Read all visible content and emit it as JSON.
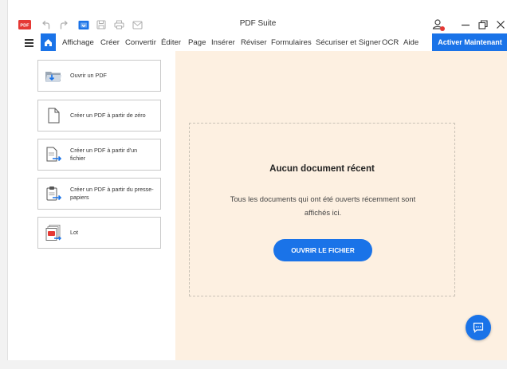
{
  "window": {
    "title": "PDF Suite",
    "logo_text": "PDF",
    "controls": [
      "minimize",
      "restore",
      "close"
    ]
  },
  "quick_access": [
    "undo-icon",
    "redo-icon",
    "open-folder-icon",
    "save-icon",
    "print-icon",
    "email-icon"
  ],
  "menu": {
    "items": [
      "Affichage",
      "Créer",
      "Convertir",
      "Éditer",
      "Page",
      "Insérer",
      "Réviser",
      "Formulaires",
      "Sécuriser et Signer",
      "OCR",
      "Aide"
    ],
    "activate_label": "Activer Maintenant"
  },
  "left_panel": {
    "actions": [
      {
        "label": "Ouvrir un PDF",
        "icon": "open-pdf-icon"
      },
      {
        "label": "Créer un PDF à partir de zéro",
        "icon": "blank-document-icon"
      },
      {
        "label": "Créer un PDF à partir d'un fichier",
        "icon": "file-to-pdf-icon"
      },
      {
        "label": "Créer un PDF à partir du presse-papiers",
        "icon": "clipboard-to-pdf-icon"
      },
      {
        "label": "Lot",
        "icon": "batch-icon"
      }
    ]
  },
  "empty_state": {
    "title": "Aucun document récent",
    "description": "Tous les documents qui ont été ouverts récemment sont affichés ici.",
    "button_label": "OUVRIR LE FICHIER"
  },
  "colors": {
    "accent": "#1a73e8",
    "content_bg": "#fdf0e1",
    "logo_red": "#e53935"
  }
}
